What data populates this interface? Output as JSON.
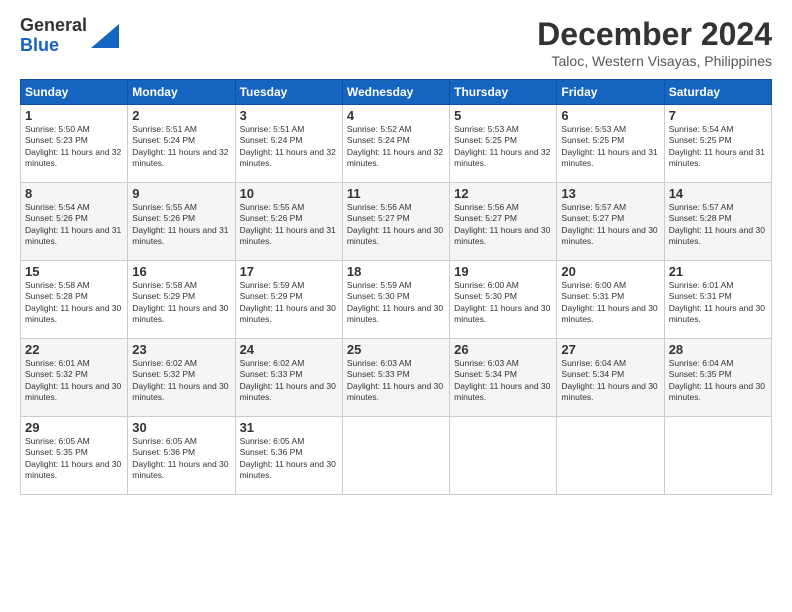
{
  "logo": {
    "line1": "General",
    "line2": "Blue"
  },
  "title": {
    "month": "December 2024",
    "location": "Taloc, Western Visayas, Philippines"
  },
  "days_of_week": [
    "Sunday",
    "Monday",
    "Tuesday",
    "Wednesday",
    "Thursday",
    "Friday",
    "Saturday"
  ],
  "weeks": [
    [
      {
        "day": "1",
        "sunrise": "5:50 AM",
        "sunset": "5:23 PM",
        "daylight": "11 hours and 32 minutes."
      },
      {
        "day": "2",
        "sunrise": "5:51 AM",
        "sunset": "5:24 PM",
        "daylight": "11 hours and 32 minutes."
      },
      {
        "day": "3",
        "sunrise": "5:51 AM",
        "sunset": "5:24 PM",
        "daylight": "11 hours and 32 minutes."
      },
      {
        "day": "4",
        "sunrise": "5:52 AM",
        "sunset": "5:24 PM",
        "daylight": "11 hours and 32 minutes."
      },
      {
        "day": "5",
        "sunrise": "5:53 AM",
        "sunset": "5:25 PM",
        "daylight": "11 hours and 32 minutes."
      },
      {
        "day": "6",
        "sunrise": "5:53 AM",
        "sunset": "5:25 PM",
        "daylight": "11 hours and 31 minutes."
      },
      {
        "day": "7",
        "sunrise": "5:54 AM",
        "sunset": "5:25 PM",
        "daylight": "11 hours and 31 minutes."
      }
    ],
    [
      {
        "day": "8",
        "sunrise": "5:54 AM",
        "sunset": "5:26 PM",
        "daylight": "11 hours and 31 minutes."
      },
      {
        "day": "9",
        "sunrise": "5:55 AM",
        "sunset": "5:26 PM",
        "daylight": "11 hours and 31 minutes."
      },
      {
        "day": "10",
        "sunrise": "5:55 AM",
        "sunset": "5:26 PM",
        "daylight": "11 hours and 31 minutes."
      },
      {
        "day": "11",
        "sunrise": "5:56 AM",
        "sunset": "5:27 PM",
        "daylight": "11 hours and 30 minutes."
      },
      {
        "day": "12",
        "sunrise": "5:56 AM",
        "sunset": "5:27 PM",
        "daylight": "11 hours and 30 minutes."
      },
      {
        "day": "13",
        "sunrise": "5:57 AM",
        "sunset": "5:27 PM",
        "daylight": "11 hours and 30 minutes."
      },
      {
        "day": "14",
        "sunrise": "5:57 AM",
        "sunset": "5:28 PM",
        "daylight": "11 hours and 30 minutes."
      }
    ],
    [
      {
        "day": "15",
        "sunrise": "5:58 AM",
        "sunset": "5:28 PM",
        "daylight": "11 hours and 30 minutes."
      },
      {
        "day": "16",
        "sunrise": "5:58 AM",
        "sunset": "5:29 PM",
        "daylight": "11 hours and 30 minutes."
      },
      {
        "day": "17",
        "sunrise": "5:59 AM",
        "sunset": "5:29 PM",
        "daylight": "11 hours and 30 minutes."
      },
      {
        "day": "18",
        "sunrise": "5:59 AM",
        "sunset": "5:30 PM",
        "daylight": "11 hours and 30 minutes."
      },
      {
        "day": "19",
        "sunrise": "6:00 AM",
        "sunset": "5:30 PM",
        "daylight": "11 hours and 30 minutes."
      },
      {
        "day": "20",
        "sunrise": "6:00 AM",
        "sunset": "5:31 PM",
        "daylight": "11 hours and 30 minutes."
      },
      {
        "day": "21",
        "sunrise": "6:01 AM",
        "sunset": "5:31 PM",
        "daylight": "11 hours and 30 minutes."
      }
    ],
    [
      {
        "day": "22",
        "sunrise": "6:01 AM",
        "sunset": "5:32 PM",
        "daylight": "11 hours and 30 minutes."
      },
      {
        "day": "23",
        "sunrise": "6:02 AM",
        "sunset": "5:32 PM",
        "daylight": "11 hours and 30 minutes."
      },
      {
        "day": "24",
        "sunrise": "6:02 AM",
        "sunset": "5:33 PM",
        "daylight": "11 hours and 30 minutes."
      },
      {
        "day": "25",
        "sunrise": "6:03 AM",
        "sunset": "5:33 PM",
        "daylight": "11 hours and 30 minutes."
      },
      {
        "day": "26",
        "sunrise": "6:03 AM",
        "sunset": "5:34 PM",
        "daylight": "11 hours and 30 minutes."
      },
      {
        "day": "27",
        "sunrise": "6:04 AM",
        "sunset": "5:34 PM",
        "daylight": "11 hours and 30 minutes."
      },
      {
        "day": "28",
        "sunrise": "6:04 AM",
        "sunset": "5:35 PM",
        "daylight": "11 hours and 30 minutes."
      }
    ],
    [
      {
        "day": "29",
        "sunrise": "6:05 AM",
        "sunset": "5:35 PM",
        "daylight": "11 hours and 30 minutes."
      },
      {
        "day": "30",
        "sunrise": "6:05 AM",
        "sunset": "5:36 PM",
        "daylight": "11 hours and 30 minutes."
      },
      {
        "day": "31",
        "sunrise": "6:05 AM",
        "sunset": "5:36 PM",
        "daylight": "11 hours and 30 minutes."
      },
      null,
      null,
      null,
      null
    ]
  ]
}
